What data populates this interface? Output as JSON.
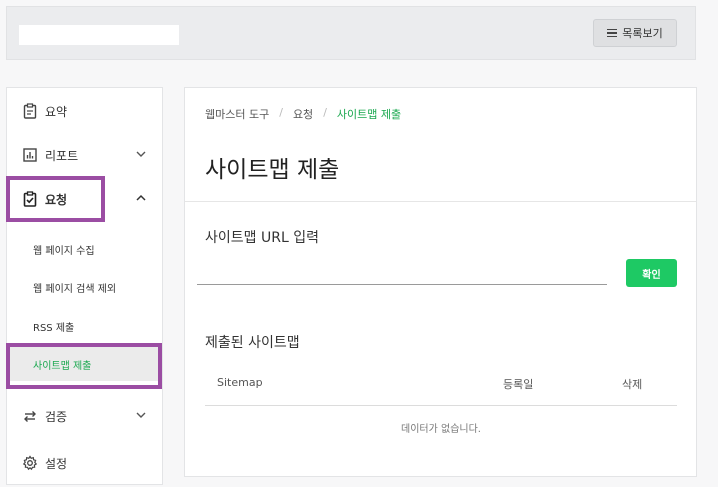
{
  "header": {
    "list_button_label": "목록보기"
  },
  "sidebar": {
    "items": [
      {
        "label": "요약",
        "icon": "clipboard-icon"
      },
      {
        "label": "리포트",
        "icon": "chart-icon"
      },
      {
        "label": "요청",
        "icon": "clipboard-check-icon"
      },
      {
        "label": "검증",
        "icon": "swap-icon"
      },
      {
        "label": "설정",
        "icon": "gear-icon"
      }
    ],
    "subitems": [
      {
        "label": "웹 페이지 수집"
      },
      {
        "label": "웹 페이지 검색 제외"
      },
      {
        "label": "RSS 제출"
      },
      {
        "label": "사이트맵 제출"
      }
    ]
  },
  "main": {
    "breadcrumb": [
      "웹마스터 도구",
      "요청",
      "사이트맵 제출"
    ],
    "title": "사이트맵 제출",
    "url_label": "사이트맵 URL 입력",
    "url_value": "",
    "confirm_label": "확인",
    "submitted_title": "제출된 사이트맵",
    "table": {
      "headers": [
        "Sitemap",
        "등록일",
        "삭제"
      ],
      "empty_text": "데이터가 없습니다."
    }
  },
  "colors": {
    "accent": "#1ec964",
    "highlight": "#9b4da3"
  }
}
